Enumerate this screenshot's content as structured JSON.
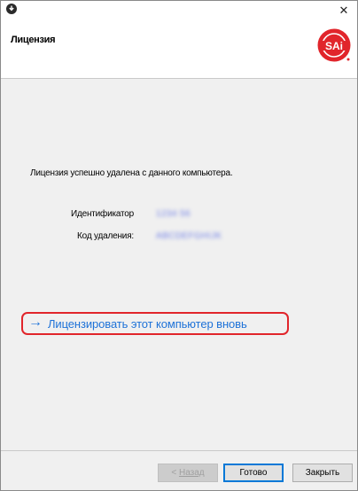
{
  "window": {
    "close_glyph": "✕"
  },
  "header": {
    "title": "Лицензия",
    "logo_text": "SAi"
  },
  "content": {
    "message": "Лицензия успешно удалена с данного компьютера.",
    "fields": [
      {
        "label": "Идентификатор",
        "value": "1234 56"
      },
      {
        "label": "Код удаления:",
        "value": "ABCDEFGHIJK"
      }
    ],
    "relicense_link": {
      "arrow": "→",
      "text": "Лицензировать этот компьютер вновь"
    }
  },
  "footer": {
    "back_prefix": "< ",
    "back_label": "Назад",
    "done_label": "Готово",
    "close_label": "Закрыть"
  },
  "colors": {
    "link": "#1e72d8",
    "highlight": "#e1252b",
    "logo_red": "#e1252b",
    "default_button_border": "#0078d7"
  }
}
